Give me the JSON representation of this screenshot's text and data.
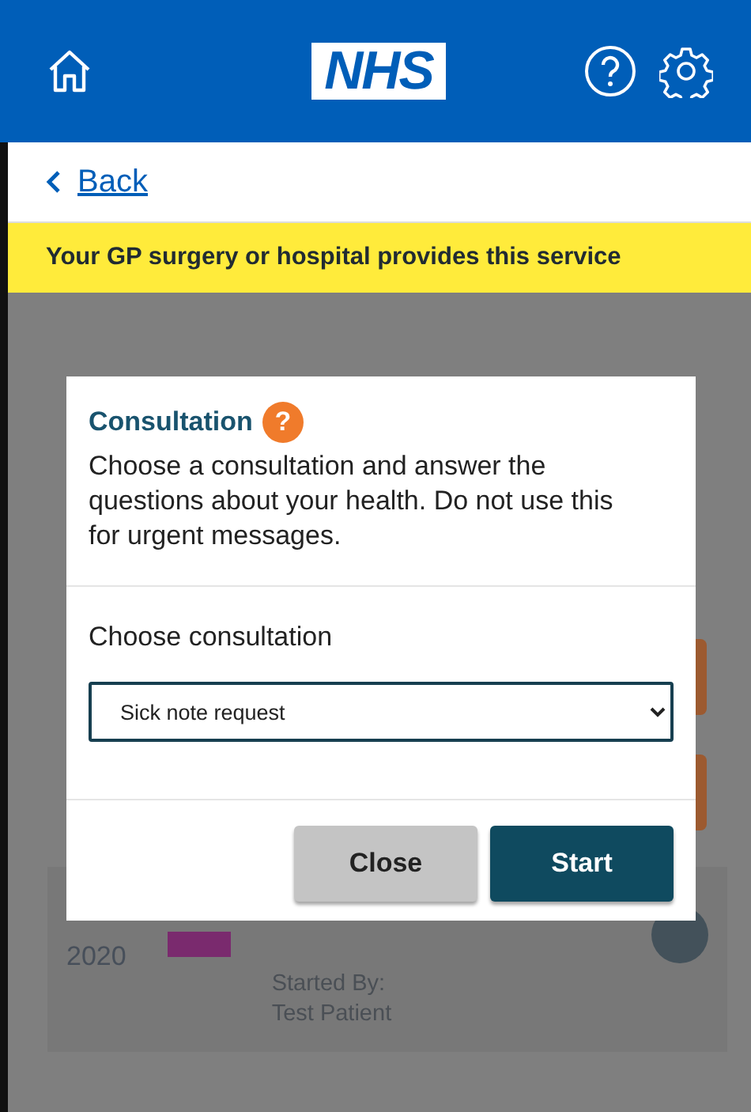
{
  "header": {
    "logo": "NHS"
  },
  "back_link": {
    "label": "Back"
  },
  "banner": {
    "text": "Your GP surgery or hospital provides this service"
  },
  "background_card": {
    "date": "2020",
    "started_by_label": "Started By:",
    "started_by": "Test Patient"
  },
  "dialog": {
    "title": "Consultation",
    "help_badge": "?",
    "description": "Choose a consultation and answer the questions about your health. Do not use this for urgent messages.",
    "select_label": "Choose consultation",
    "select_value": "Sick note request",
    "buttons": [
      {
        "label": "Close",
        "kind": "secondary"
      },
      {
        "label": "Start",
        "kind": "primary"
      }
    ]
  }
}
